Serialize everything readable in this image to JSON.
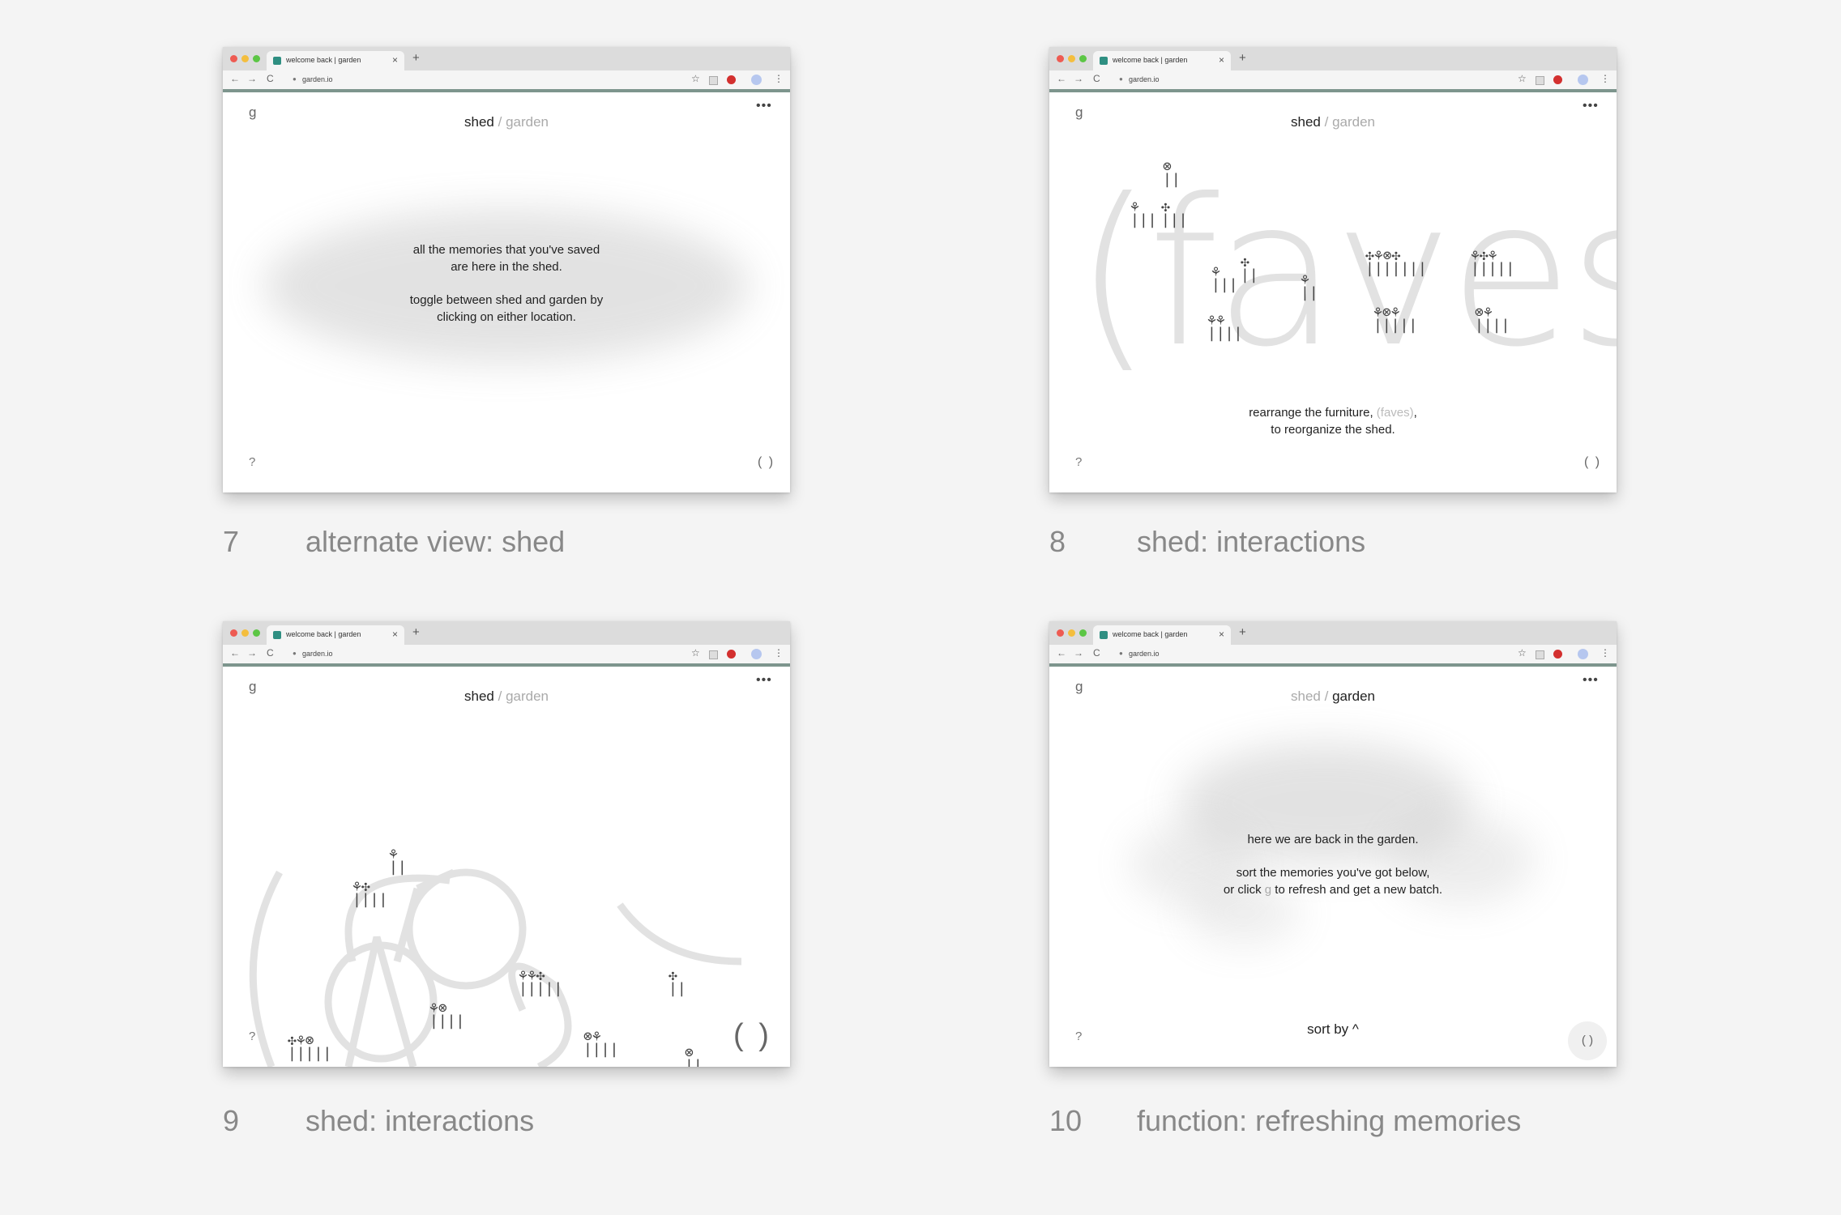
{
  "browser": {
    "tab_title": "welcome back | garden",
    "tab_close": "×",
    "new_tab": "+",
    "url": "garden.io",
    "back": "←",
    "forward": "→",
    "reload": "C",
    "lock": "🔒",
    "star": "☆",
    "menu": "⋮"
  },
  "app": {
    "logo": "g",
    "more": "•••",
    "shed": "shed",
    "garden": "garden",
    "sep": "/",
    "help": "?",
    "faves_button": "( )"
  },
  "panels": [
    {
      "number": "7",
      "caption": "alternate view: shed",
      "active_location": "shed",
      "msg1": "all the memories that you've saved are here in the shed.",
      "msg2": "toggle between shed and garden by clicking on either location."
    },
    {
      "number": "8",
      "caption": "shed: interactions",
      "active_location": "shed",
      "big_word": "(faves)",
      "msg_pre": "rearrange the furniture, ",
      "msg_highlight": "(faves)",
      "msg_post": ",",
      "msg_line2": "to reorganize the shed."
    },
    {
      "number": "9",
      "caption": "shed: interactions",
      "active_location": "shed",
      "scattered_word": "(faves)"
    },
    {
      "number": "10",
      "caption": "function: refreshing memories",
      "active_location": "garden",
      "msg1": "here we are back in the garden.",
      "msg2_line1": "sort the memories you've got below,",
      "msg2_pre": "or click ",
      "msg2_g": "g",
      "msg2_post": " to refresh and get a new batch.",
      "sort_label": "sort by ^"
    }
  ],
  "colors": {
    "accent": "#7d958d",
    "page_bg": "#f4f4f4",
    "faves_letters": "#e2e2e2"
  }
}
